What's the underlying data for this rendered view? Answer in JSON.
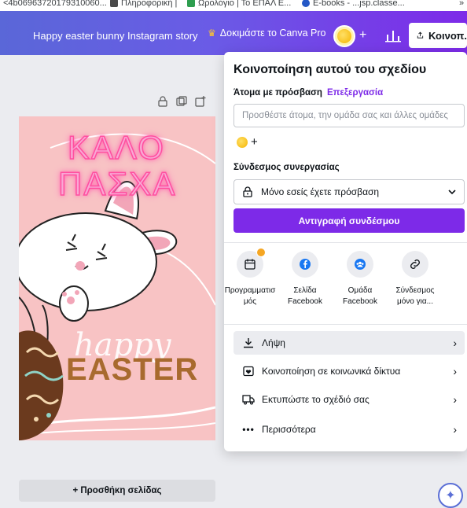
{
  "browser": {
    "bookmarks": [
      "<4b06963720179310060...",
      "Πληροφορική |",
      "Ωρολόγιο | Το ΕΠΑΛ Ε...",
      "E-books - ...jsp.classe...",
      "»"
    ]
  },
  "topbar": {
    "title": "Happy easter bunny Instagram story",
    "try_pro": "Δοκιμάστε το Canva Pro",
    "add": "+",
    "share": "Κοινοπ."
  },
  "canvas": {
    "design_title_line1": "ΚΑΛΟ",
    "design_title_line2": "ΠΑΣΧΑ",
    "design_happy": "happy",
    "design_easter": "EASTER",
    "add_page": "+ Προσθήκη σελίδας"
  },
  "share_panel": {
    "title": "Κοινοποίηση αυτού του σχεδίου",
    "people_label": "Άτομα με πρόσβαση",
    "edit_link": "Επεξεργασία",
    "people_placeholder": "Προσθέστε άτομα, την ομάδα σας και άλλες ομάδες",
    "add_plus": "+",
    "collab_label": "Σύνδεσμος συνεργασίας",
    "access_value": "Μόνο εσείς έχετε πρόσβαση",
    "copy_link": "Αντιγραφή συνδέσμου",
    "share_options": [
      {
        "label_line1": "Προγραμματισ",
        "label_line2": "μός",
        "icon": "calendar-icon"
      },
      {
        "label_line1": "Σελίδα",
        "label_line2": "Facebook",
        "icon": "facebook-icon"
      },
      {
        "label_line1": "Ομάδα",
        "label_line2": "Facebook",
        "icon": "facebook-group-icon"
      },
      {
        "label_line1": "Σύνδεσμος",
        "label_line2": "μόνο για...",
        "icon": "link-icon"
      }
    ],
    "menu": [
      {
        "label": "Λήψη",
        "icon": "download-icon"
      },
      {
        "label": "Κοινοποίηση σε κοινωνικά δίκτυα",
        "icon": "heart-social-icon"
      },
      {
        "label": "Εκτυπώστε το σχέδιό σας",
        "icon": "truck-icon"
      },
      {
        "label": "Περισσότερα",
        "icon": "more-icon"
      }
    ]
  },
  "colors": {
    "brand_purple": "#7d2ae8",
    "topbar_start": "#5a67d8",
    "design_pink": "#f8c3c4"
  }
}
